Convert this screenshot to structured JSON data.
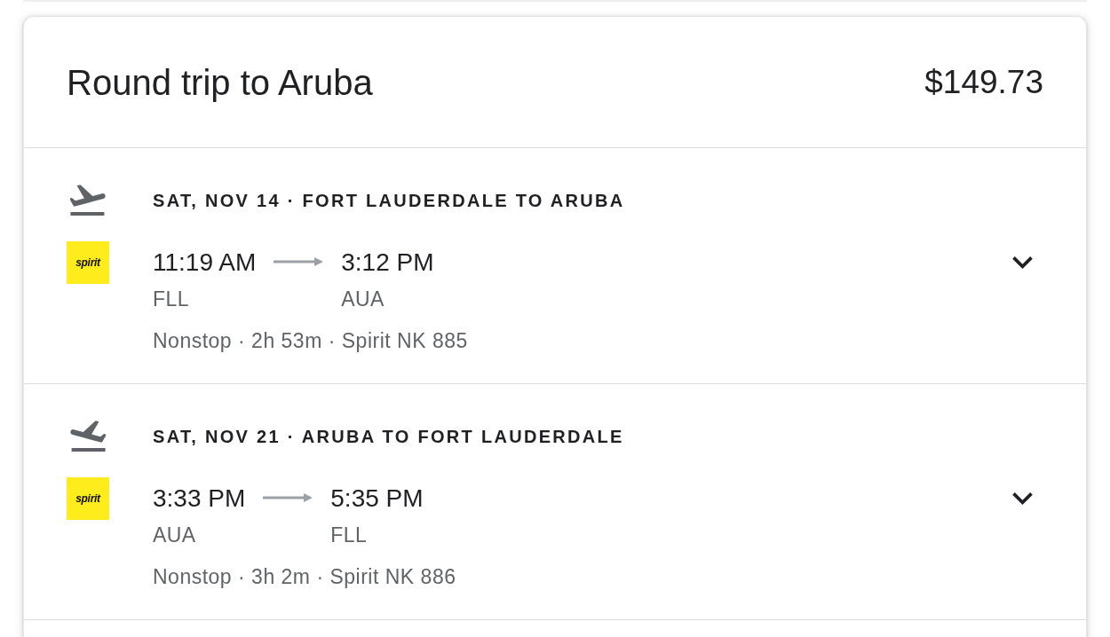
{
  "trip": {
    "title": "Round trip to Aruba",
    "price": "$149.73"
  },
  "flights": [
    {
      "kind": "outbound",
      "heading": "SAT, NOV 14 · FORT LAUDERDALE TO ARUBA",
      "airline_logo": "spirit",
      "departure": {
        "time": "11:19 AM",
        "airport": "FLL"
      },
      "arrival": {
        "time": "3:12 PM",
        "airport": "AUA"
      },
      "details": "Nonstop · 2h 53m · Spirit NK 885",
      "expanded": false
    },
    {
      "kind": "return",
      "heading": "SAT, NOV 21 · ARUBA TO FORT LAUDERDALE",
      "airline_logo": "spirit",
      "departure": {
        "time": "3:33 PM",
        "airport": "AUA"
      },
      "arrival": {
        "time": "5:35 PM",
        "airport": "FLL"
      },
      "details": "Nonstop · 3h 2m · Spirit NK 886",
      "expanded": false
    }
  ]
}
